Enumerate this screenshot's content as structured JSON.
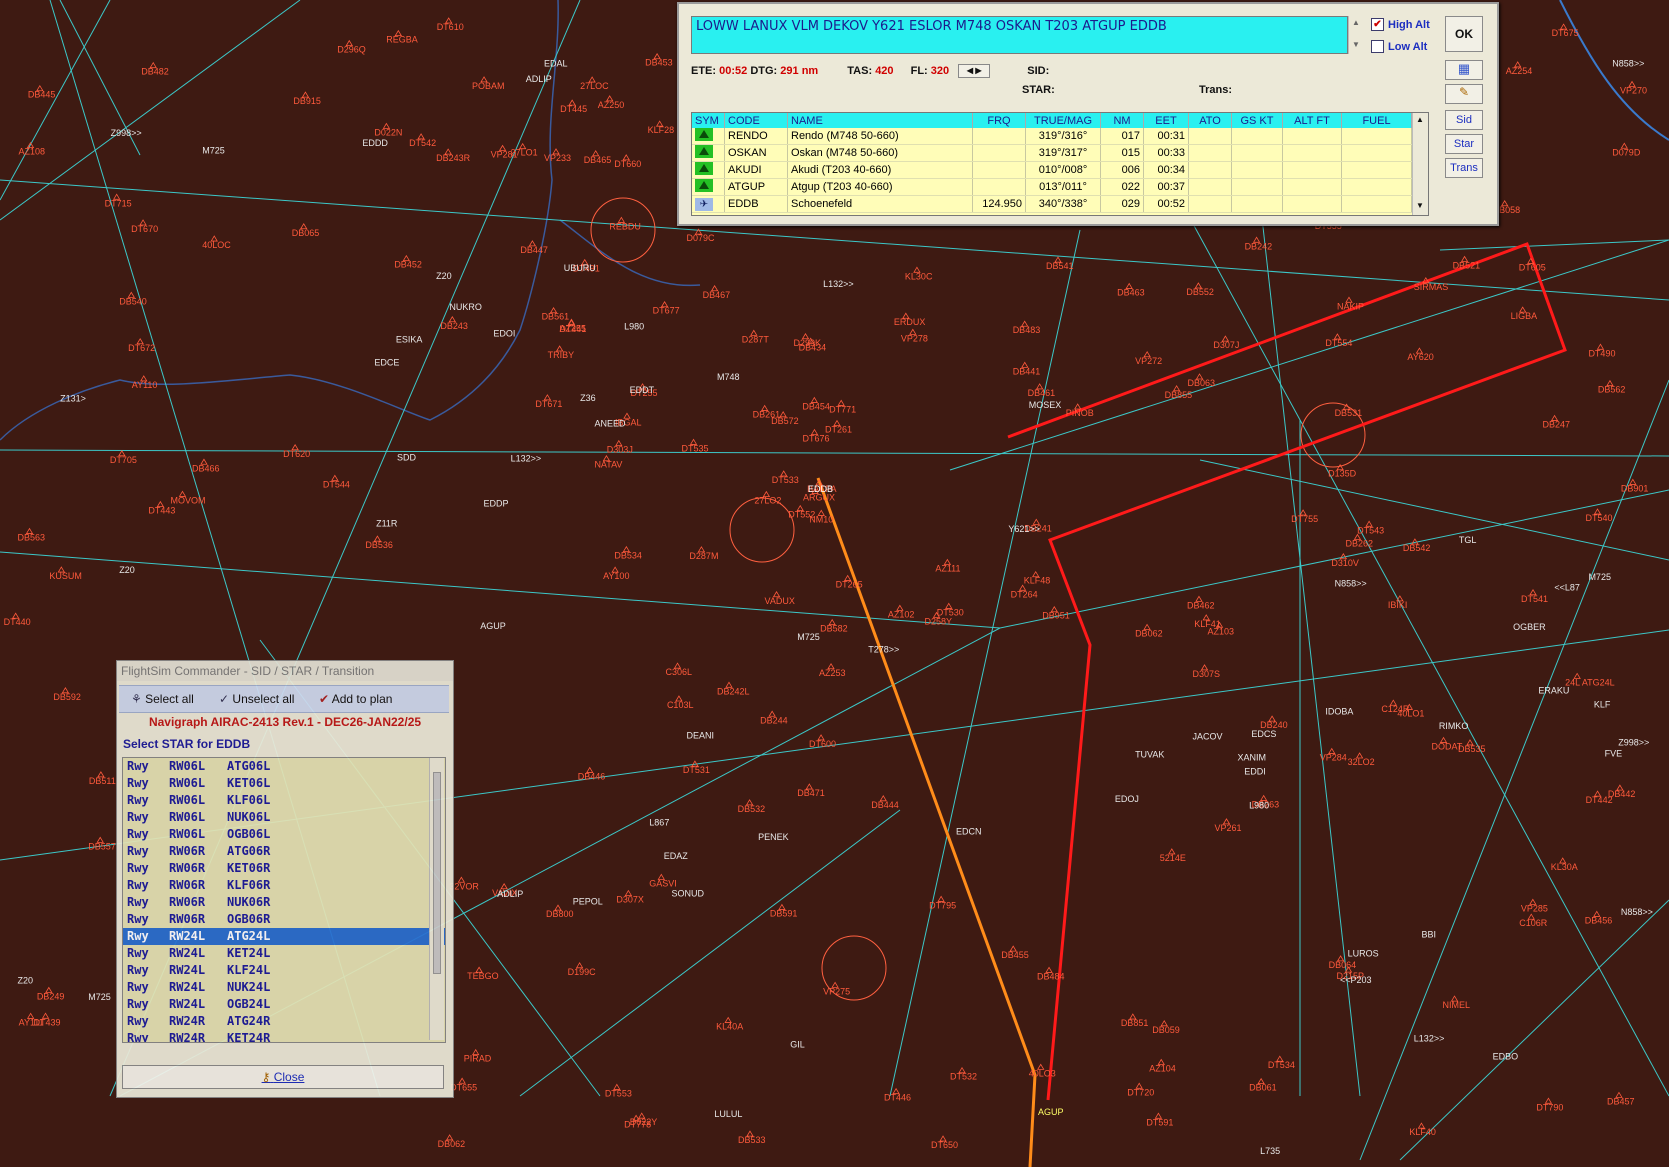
{
  "map": {
    "nav_labels_cyan": [
      "Z11R",
      "GIL",
      "ANEED",
      "M725",
      "L867",
      "EDCE",
      "L132>>",
      "L980",
      "TUVAK",
      "EDAL",
      "FVE",
      "L980",
      "M725",
      "Z20",
      "JACOV",
      "IDOBA",
      "N858>>",
      "Z20",
      "SONUD",
      "M725",
      "DEANI",
      "N858>>",
      "Y621>>",
      "PEPOL",
      "L132>>",
      "M725",
      "Z36",
      "NUKRO",
      "L132>>",
      "N858>>",
      "L735",
      "LUROS",
      "Z20",
      "M748",
      "ESIKA",
      "MOSEX",
      "EDBO",
      "EDDD",
      "T278>>",
      "Z131>",
      "Z998>>",
      "<<L87",
      "<<P203",
      "Z998>>",
      "ADLIP",
      "EDDP",
      "EDCS",
      "EDAZ",
      "EDDI",
      "EDOJ",
      "LULUL",
      "PENEK",
      "OGBER",
      "RIMKO",
      "EDOI",
      "EDCN",
      "ERAKU",
      "TGL",
      "EDDT",
      "KLF",
      "BBI",
      "SDD",
      "ADLIP",
      "UBURU",
      "XANIM",
      "AGUP"
    ],
    "nav_labels_orange": [
      "D215P",
      "D135D",
      "KLF48",
      "DT534",
      "DT535",
      "DT532",
      "DT531",
      "PIRAD",
      "DT530",
      "VADUX",
      "VP285",
      "DT264",
      "DT265",
      "VP281",
      "VP278",
      "DT533",
      "DT620",
      "VP284",
      "DT771",
      "DT255",
      "DT261",
      "DT591",
      "DT720",
      "KLF41",
      "DT655",
      "DT552",
      "LIGBA",
      "REGBA",
      "DT553",
      "DB511",
      "DT605",
      "DT600",
      "DT650",
      "D296Q",
      "KUSUM",
      "DB244",
      "VP270",
      "DT540",
      "DB243",
      "DT541",
      "DT554",
      "D258Y",
      "DT555",
      "KL40A",
      "KLF40",
      "DT543",
      "DT544",
      "DT670",
      "DB521",
      "DT542",
      "ERDUX",
      "NAKIP",
      "VP261",
      "DT439",
      "DT440",
      "DB915",
      "DT441",
      "VP272",
      "AY110",
      "D287T",
      "DB065",
      "DT442",
      "DT755",
      "DT705",
      "AY100",
      "DB062",
      "D287M",
      "DT443",
      "AY111",
      "AY620",
      "D299K",
      "D303J",
      "NM10",
      "C124R",
      "DB453",
      "DB452",
      "KLF28",
      "DB434",
      "DT445",
      "DT446",
      "DB447",
      "DB457",
      "DB446",
      "PINOB",
      "DB456",
      "DB445",
      "DB455",
      "DB444",
      "DB454",
      "DB467",
      "DB466",
      "DB465",
      "DB800",
      "DB463",
      "DB462",
      "DB442",
      "D022Y",
      "DB851",
      "DB059",
      "DB063",
      "DB441",
      "DB461",
      "ARGUX",
      "DB064",
      "D199C",
      "DB855",
      "DB531",
      "DB242",
      "KL30A",
      "KL30C",
      "DB533",
      "DB532",
      "DB241",
      "DB247",
      "REBDU",
      "NIMEL",
      "DB534",
      "BAKPA",
      "IBGAL",
      "DB535",
      "D307X",
      "VAVIX",
      "C306L",
      "C106R",
      "TEBGO",
      "POBAM",
      "DT671",
      "DB536",
      "DB542",
      "D310V",
      "DB552",
      "DB261",
      "DB263",
      "AZ250",
      "MOVOM",
      "DODAT",
      "DB541",
      "TRIBY",
      "DB561",
      "DB562",
      "AZ102",
      "AZ103",
      "DB951",
      "AZ253",
      "IBIKI",
      "DB262",
      "DT672",
      "D307J",
      "DB572",
      "DT677",
      "DT675",
      "AZ254",
      "AZ108",
      "AZ104",
      "AZ255",
      "AZ111",
      "DT676",
      "DB592",
      "DB582",
      "DB591",
      "DB483",
      "DT790",
      "DT795",
      "DB484",
      "DB249",
      "DB482",
      "NATAV",
      "DB471",
      "GASVI",
      "D022N",
      "SIRMAS",
      "DB061",
      "DB062",
      "VP233",
      "DT715",
      "DT778",
      "DB557",
      "DB540",
      "D307S",
      "C103L",
      "DB901",
      "DB563",
      "DT660",
      "DT490",
      "D079C",
      "D079D",
      "DT610",
      "DT491",
      "VP275",
      "40LOC",
      "27LOC",
      "32VOR",
      "27LO1",
      "40LO1",
      "DB240",
      "32LO2",
      "DB243R",
      "DB242L",
      "27LO2",
      "40LO3",
      "DB058",
      "5214E",
      "24L ATG24L"
    ],
    "orange_route_label": "EDDB",
    "red_route_label": "AGUP"
  },
  "flight_plan": {
    "route": "LOWW LANUX VLM DEKOV Y621 ESLOR M748 OSKAN T203 ATGUP EDDB",
    "high_alt_label": "High Alt",
    "low_alt_label": "Low Alt",
    "high_alt_checked": true,
    "low_alt_checked": false,
    "ok_label": "OK",
    "sid_btn": "Sid",
    "star_btn": "Star",
    "trans_btn": "Trans",
    "ete_label": "ETE:",
    "ete": "00:52",
    "dtg_label": "DTG:",
    "dtg": "291 nm",
    "tas_label": "TAS:",
    "tas": "420",
    "fl_label": "FL:",
    "fl": "320",
    "sid_label": "SID:",
    "star_label": "STAR:",
    "trans_label": "Trans:",
    "columns": [
      "SYM",
      "CODE",
      "NAME",
      "FRQ",
      "TRUE/MAG",
      "NM",
      "EET",
      "ATO",
      "GS KT",
      "ALT FT",
      "FUEL"
    ],
    "rows": [
      {
        "sym": "waypoint",
        "code": "RENDO",
        "name": "Rendo (M748 50-660)",
        "frq": "",
        "true_mag": "319°/316°",
        "nm": "017",
        "eet": "00:31"
      },
      {
        "sym": "waypoint",
        "code": "OSKAN",
        "name": "Oskan (M748 50-660)",
        "frq": "",
        "true_mag": "319°/317°",
        "nm": "015",
        "eet": "00:33"
      },
      {
        "sym": "waypoint",
        "code": "AKUDI",
        "name": "Akudi (T203 40-660)",
        "frq": "",
        "true_mag": "010°/008°",
        "nm": "006",
        "eet": "00:34"
      },
      {
        "sym": "waypoint",
        "code": "ATGUP",
        "name": "Atgup (T203 40-660)",
        "frq": "",
        "true_mag": "013°/011°",
        "nm": "022",
        "eet": "00:37"
      },
      {
        "sym": "airport",
        "code": "EDDB",
        "name": "Schoenefeld",
        "frq": "124.950",
        "true_mag": "340°/338°",
        "nm": "029",
        "eet": "00:52"
      }
    ]
  },
  "star_window": {
    "title": "FlightSim Commander - SID / STAR / Transition",
    "select_all": "Select all",
    "unselect_all": "Unselect all",
    "add_to_plan": "Add to plan",
    "airac": "Navigraph AIRAC-2413 Rev.1 - DEC26-JAN22/25",
    "select_label": "Select STAR for EDDB",
    "items": [
      [
        "Rwy",
        "RW06L",
        "ATG06L"
      ],
      [
        "Rwy",
        "RW06L",
        "KET06L"
      ],
      [
        "Rwy",
        "RW06L",
        "KLF06L"
      ],
      [
        "Rwy",
        "RW06L",
        "NUK06L"
      ],
      [
        "Rwy",
        "RW06L",
        "OGB06L"
      ],
      [
        "Rwy",
        "RW06R",
        "ATG06R"
      ],
      [
        "Rwy",
        "RW06R",
        "KET06R"
      ],
      [
        "Rwy",
        "RW06R",
        "KLF06R"
      ],
      [
        "Rwy",
        "RW06R",
        "NUK06R"
      ],
      [
        "Rwy",
        "RW06R",
        "OGB06R"
      ],
      [
        "Rwy",
        "RW24L",
        "ATG24L"
      ],
      [
        "Rwy",
        "RW24L",
        "KET24L"
      ],
      [
        "Rwy",
        "RW24L",
        "KLF24L"
      ],
      [
        "Rwy",
        "RW24L",
        "NUK24L"
      ],
      [
        "Rwy",
        "RW24L",
        "OGB24L"
      ],
      [
        "Rwy",
        "RW24R",
        "ATG24R"
      ],
      [
        "Rwy",
        "RW24R",
        "KET24R"
      ]
    ],
    "selected_index": 10,
    "close_label": "Close"
  },
  "colors": {
    "background": "#3e1a12",
    "airway": "#3cc8c8",
    "fix": "#ff5a3c",
    "route_red": "#ff1a1a",
    "route_orange": "#ff8c1a",
    "selection": "#2a6fd1"
  }
}
